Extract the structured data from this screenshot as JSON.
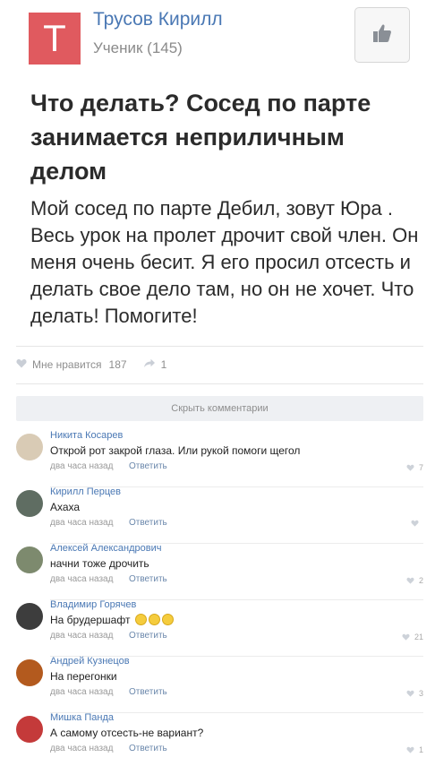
{
  "author": {
    "avatar_letter": "Т",
    "name": "Трусов Кирилл",
    "rank": "Ученик (145)",
    "avatar_color": "#e05a5f"
  },
  "question": {
    "title": "Что делать? Сосед по парте занимается неприличным делом",
    "body": "Мой сосед по парте Дебил, зовут Юра . Весь урок на пролет дрочит свой член. Он меня очень бесит. Я его просил отсесть и делать свое дело там, но он не хочет. Что делать! Помогите!"
  },
  "stats": {
    "likes_label": "Мне нравится",
    "likes_count": "187",
    "reposts_count": "1"
  },
  "hide_comments_label": "Скрыть комментарии",
  "comments": [
    {
      "name": "Никита Косарев",
      "text": "Открой рот закрой глаза. Или рукой помоги щегол",
      "time": "два часа назад",
      "reply": "Ответить",
      "likes": "7"
    },
    {
      "name": "Кирилл Перцев",
      "text": "Ахаха",
      "time": "два часа назад",
      "reply": "Ответить",
      "likes": ""
    },
    {
      "name": "Алексей Александрович",
      "text": "начни тоже дрочить",
      "time": "два часа назад",
      "reply": "Ответить",
      "likes": "2"
    },
    {
      "name": "Владимир Горячев",
      "text": "На брудершафт",
      "time": "два часа назад",
      "reply": "Ответить",
      "likes": "21"
    },
    {
      "name": "Андрей Кузнецов",
      "text": "На перегонки",
      "time": "два часа назад",
      "reply": "Ответить",
      "likes": "3"
    },
    {
      "name": "Мишка Панда",
      "text": "А самому отсесть-не вариант?",
      "time": "два часа назад",
      "reply": "Ответить",
      "likes": "1"
    }
  ],
  "colors": {
    "link": "#4a78b4",
    "muted": "#8e8e8e"
  }
}
